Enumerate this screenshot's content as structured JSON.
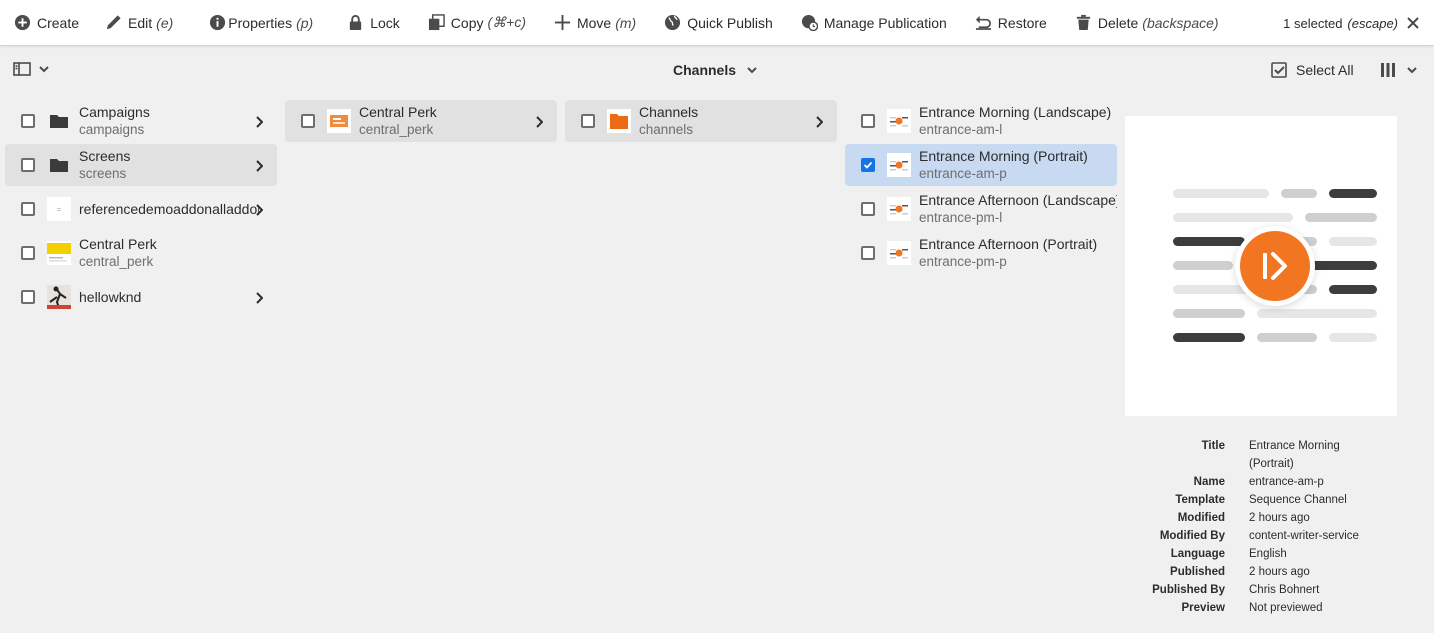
{
  "actionbar": {
    "create": "Create",
    "edit": "Edit",
    "edit_key": "(e)",
    "properties": "Properties",
    "properties_key": "(p)",
    "lock": "Lock",
    "copy": "Copy",
    "copy_key": "(⌘+c)",
    "move": "Move",
    "move_key": "(m)",
    "quick_publish": "Quick Publish",
    "manage_publication": "Manage Publication",
    "restore": "Restore",
    "delete": "Delete",
    "delete_key": "(backspace)",
    "selection": "1 selected",
    "selection_key": "(escape)"
  },
  "subbar": {
    "title": "Channels",
    "select_all": "Select All"
  },
  "columns": {
    "col1": [
      {
        "title": "Campaigns",
        "name": "campaigns",
        "icon": "folder-icon"
      },
      {
        "title": "Screens",
        "name": "screens",
        "icon": "folder-icon"
      },
      {
        "title": "referencedemoaddonalladdons",
        "name": "",
        "icon": "page-thumbnail"
      },
      {
        "title": "Central Perk",
        "name": "central_perk",
        "icon": "yellow-thumbnail"
      },
      {
        "title": "hellowknd",
        "name": "",
        "icon": "photo-thumbnail"
      }
    ],
    "col2": [
      {
        "title": "Central Perk",
        "name": "central_perk",
        "icon": "project-thumbnail"
      }
    ],
    "col3": [
      {
        "title": "Channels",
        "name": "channels",
        "icon": "orange-folder-icon"
      }
    ],
    "col4": [
      {
        "title": "Entrance Morning (Landscape)",
        "name": "entrance-am-l",
        "icon": "channel-thumbnail"
      },
      {
        "title": "Entrance Morning (Portrait)",
        "name": "entrance-am-p",
        "icon": "channel-thumbnail"
      },
      {
        "title": "Entrance Afternoon (Landscape)",
        "name": "entrance-pm-l",
        "icon": "channel-thumbnail"
      },
      {
        "title": "Entrance Afternoon (Portrait)",
        "name": "entrance-pm-p",
        "icon": "channel-thumbnail"
      }
    ]
  },
  "meta": {
    "title_label": "Title",
    "title_value": "Entrance Morning (Portrait)",
    "name_label": "Name",
    "name_value": "entrance-am-p",
    "template_label": "Template",
    "template_value": "Sequence Channel",
    "modified_label": "Modified",
    "modified_value": "2 hours ago",
    "modified_by_label": "Modified By",
    "modified_by_value": "content-writer-service",
    "language_label": "Language",
    "language_value": "English",
    "published_label": "Published",
    "published_value": "2 hours ago",
    "published_by_label": "Published By",
    "published_by_value": "Chris Bohnert",
    "preview_label": "Preview",
    "preview_value": "Not previewed"
  },
  "colors": {
    "accent": "#1473e6",
    "selected_row": "#c8daf2",
    "brand_orange": "#f27521"
  }
}
